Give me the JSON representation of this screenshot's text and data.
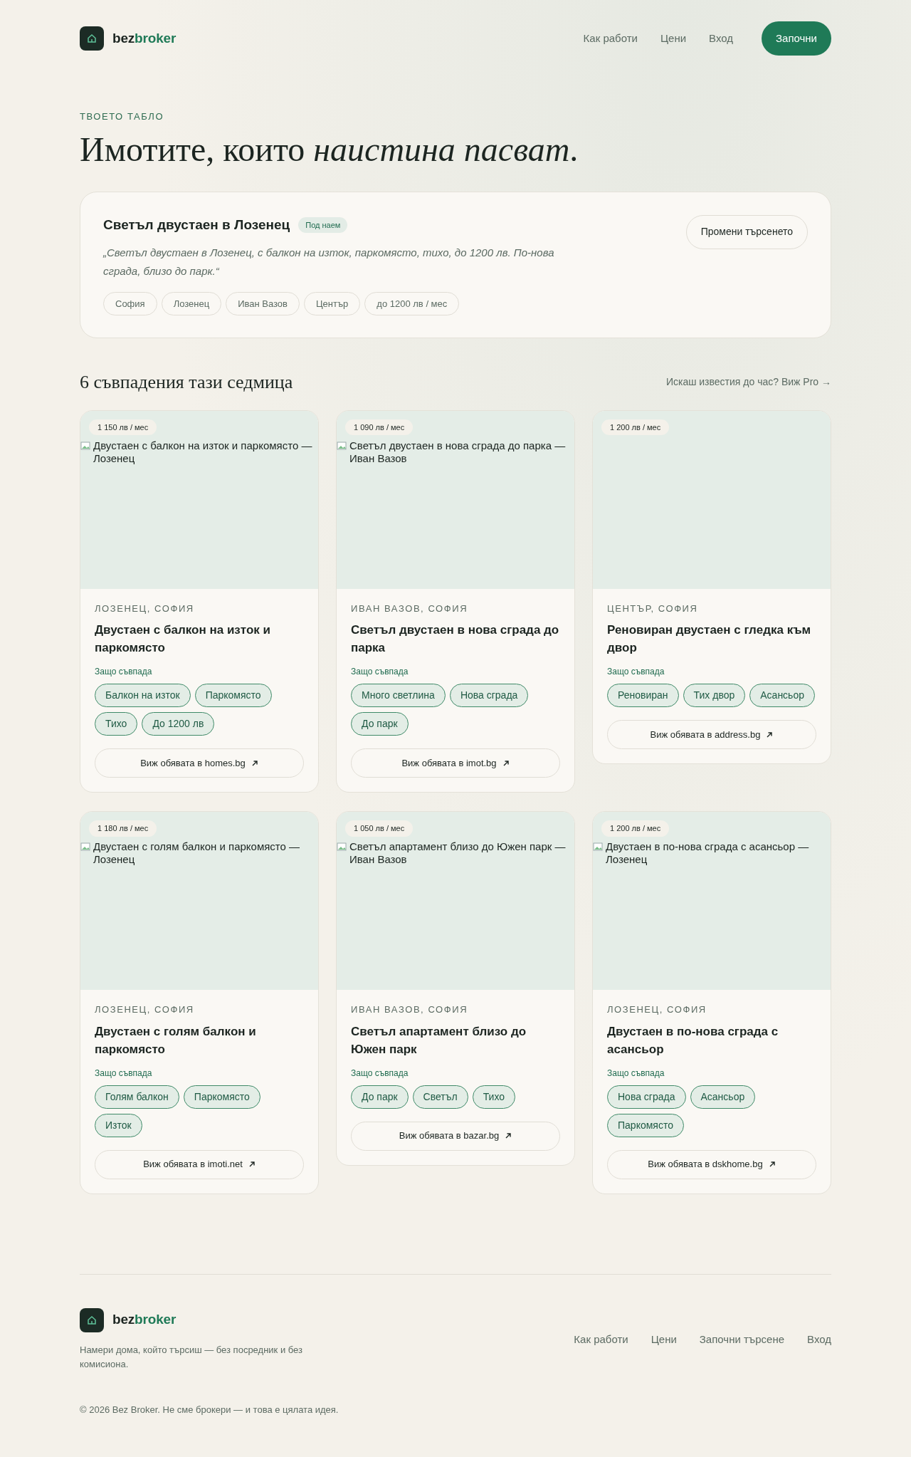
{
  "brand": {
    "prefix": "bez",
    "suffix": "broker"
  },
  "nav": [
    {
      "label": "Как работи"
    },
    {
      "label": "Цени"
    },
    {
      "label": "Вход"
    }
  ],
  "cta": "Започни",
  "eyebrow": "ТВОЕТО ТАБЛО",
  "headline": "Имотите, които *наистина пасват*.",
  "search": {
    "title": "Светъл двустаен в Лозенец",
    "badge": "Под наем",
    "query": "„Светъл двустаен в Лозенец, с балкон на изток, паркомясто, тихо, до 1200 лв. По-нова сграда, близо до парк.“",
    "chips": [
      "София",
      "Лозенец",
      "Иван Вазов",
      "Център",
      "до 1200 лв / мес"
    ],
    "button": "Промени търсенето"
  },
  "results": {
    "title": "6 съвпадения тази седмица",
    "link": "Искаш известия до час? Виж Pro →"
  },
  "listings": [
    {
      "image_alt": "Двустаен с балкон на изток и паркомясто — Лозенец",
      "price": "1 150 лв / мес",
      "location": "ЛОЗЕНЕЦ, СОФИЯ",
      "title": "Двустаен с балкон на изток и паркомясто",
      "why": "Защо съвпада",
      "tags": [
        "Балкон на изток",
        "Паркомясто",
        "Тихо",
        "До 1200 лв"
      ],
      "link": "Виж обявата в homes.bg"
    },
    {
      "image_alt": "Светъл двустаен в нова сграда до парка — Иван Вазов",
      "price": "1 090 лв / мес",
      "location": "ИВАН ВАЗОВ, СОФИЯ",
      "title": "Светъл двустаен в нова сграда до парка",
      "why": "Защо съвпада",
      "tags": [
        "Много светлина",
        "Нова сграда",
        "До парк"
      ],
      "link": "Виж обявата в imot.bg"
    },
    {
      "price": "1 200 лв / мес",
      "location": "ЦЕНТЪР, СОФИЯ",
      "title": "Реновиран двустаен с гледка към двор",
      "why": "Защо съвпада",
      "tags": [
        "Реновиран",
        "Тих двор",
        "Асансьор"
      ],
      "link": "Виж обявата в address.bg"
    },
    {
      "image_alt": "Двустаен с голям балкон и паркомясто — Лозенец",
      "price": "1 180 лв / мес",
      "location": "ЛОЗЕНЕЦ, СОФИЯ",
      "title": "Двустаен с голям балкон и паркомясто",
      "why": "Защо съвпада",
      "tags": [
        "Голям балкон",
        "Паркомясто",
        "Изток"
      ],
      "link": "Виж обявата в imoti.net"
    },
    {
      "image_alt": "Светъл апартамент близо до Южен парк — Иван Вазов",
      "price": "1 050 лв / мес",
      "location": "ИВАН ВАЗОВ, СОФИЯ",
      "title": "Светъл апартамент близо до Южен парк",
      "why": "Защо съвпада",
      "tags": [
        "До парк",
        "Светъл",
        "Тихо"
      ],
      "link": "Виж обявата в bazar.bg"
    },
    {
      "image_alt": "Двустаен в по-нова сграда с асансьор — Лозенец",
      "price": "1 200 лв / мес",
      "location": "ЛОЗЕНЕЦ, СОФИЯ",
      "title": "Двустаен в по-нова сграда с асансьор",
      "why": "Защо съвпада",
      "tags": [
        "Нова сграда",
        "Асансьор",
        "Паркомясто"
      ],
      "link": "Виж обявата в dskhome.bg"
    }
  ],
  "footer": {
    "brand": {
      "prefix": "bez",
      "suffix": "broker"
    },
    "tagline": "Намери дома, който търсиш — без посредник и без комисиона.",
    "links": [
      {
        "label": "Как работи"
      },
      {
        "label": "Цени"
      },
      {
        "label": "Започни търсене"
      },
      {
        "label": "Вход"
      }
    ],
    "copyright": "© 2026 Bez Broker. Не сме брокери — и това е цялата идея."
  }
}
